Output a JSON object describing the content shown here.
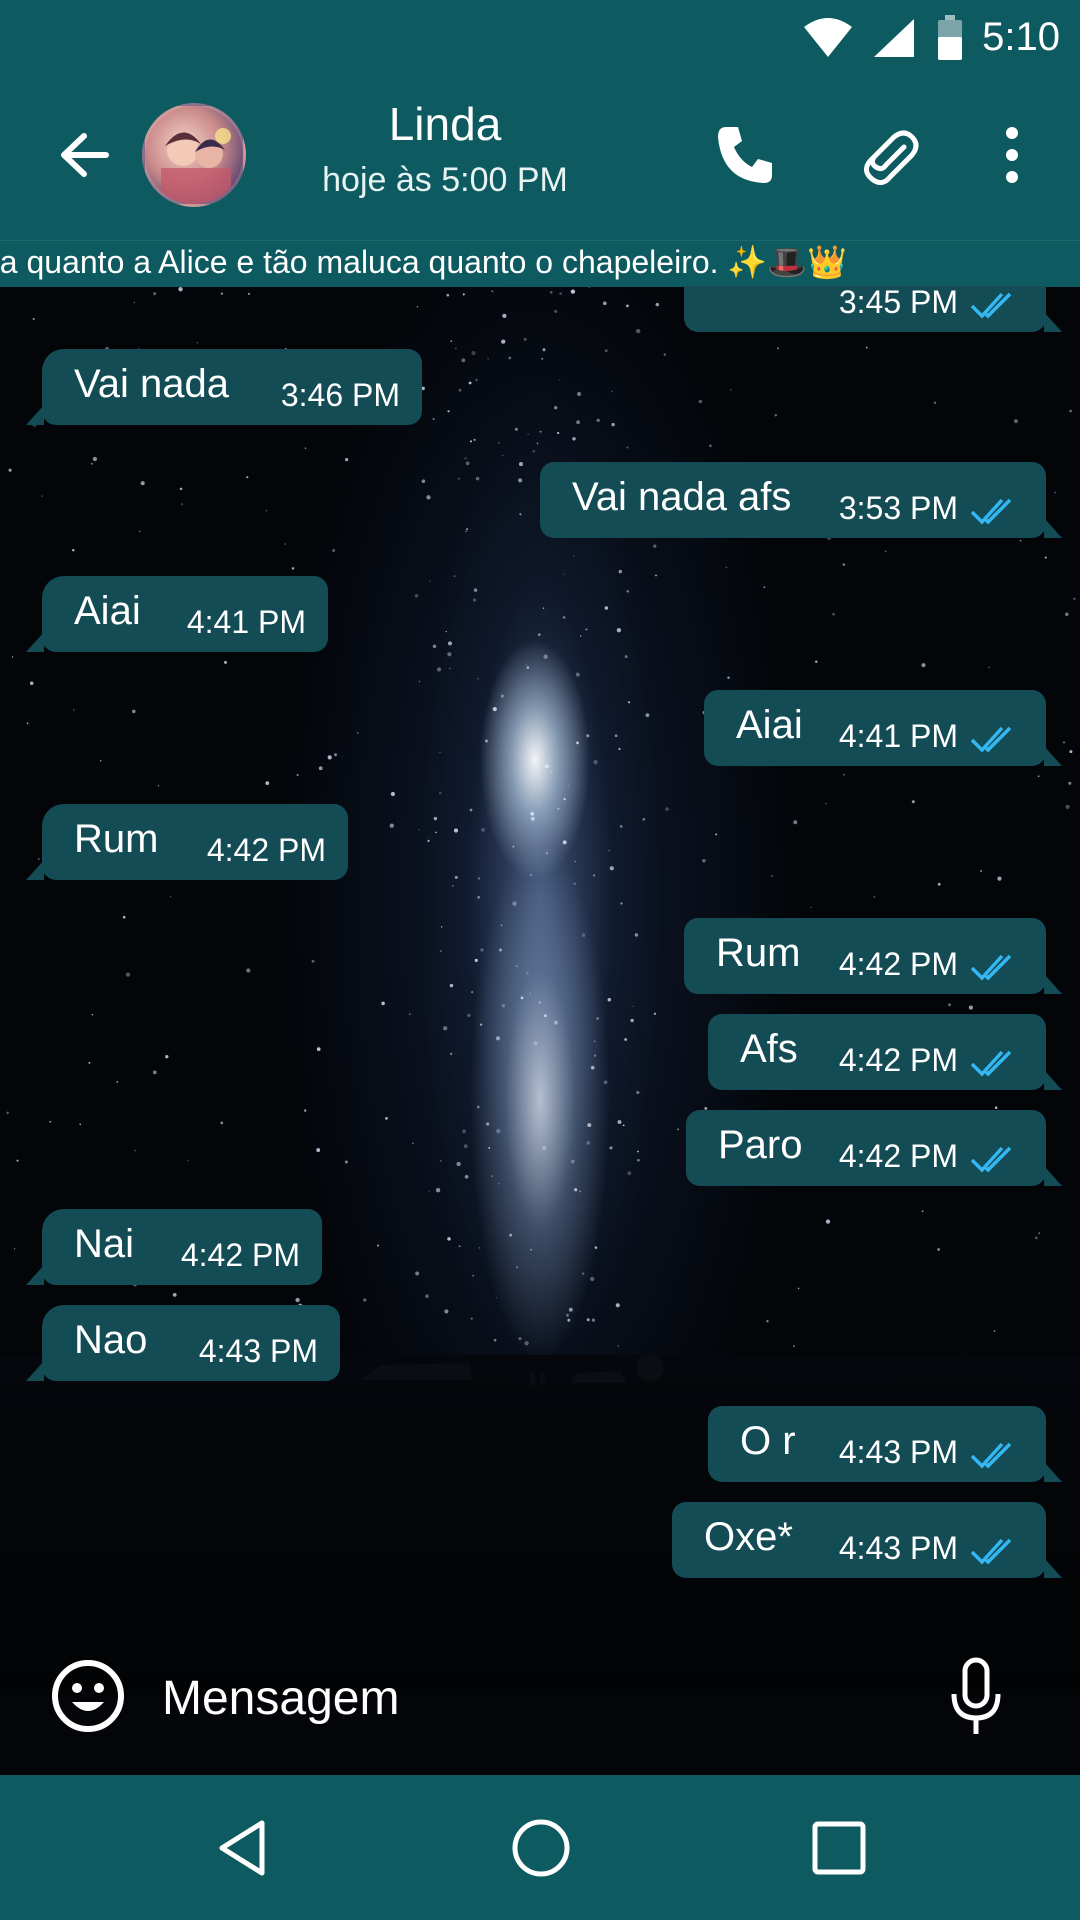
{
  "status_bar": {
    "time": "5:10",
    "icons": [
      "wifi-icon",
      "signal-icon",
      "battery-icon"
    ]
  },
  "header": {
    "contact_name": "Linda",
    "last_seen": "hoje às 5:00 PM",
    "actions": [
      "call-icon",
      "attach-icon",
      "more-vert-icon"
    ]
  },
  "marquee": {
    "text": "da quanto a Alice e tão maluca quanto o chapeleiro. ✨🎩👑"
  },
  "messages": [
    {
      "dir": "out",
      "text": "",
      "time": "3:45 PM",
      "partial": true
    },
    {
      "dir": "in",
      "text": "Vai nada",
      "time": "3:46 PM"
    },
    {
      "dir": "out",
      "text": "Vai nada afs",
      "time": "3:53 PM"
    },
    {
      "dir": "in",
      "text": "Aiai",
      "time": "4:41 PM"
    },
    {
      "dir": "out",
      "text": "Aiai",
      "time": "4:41 PM"
    },
    {
      "dir": "in",
      "text": "Rum",
      "time": "4:42 PM"
    },
    {
      "dir": "out",
      "text": "Rum",
      "time": "4:42 PM"
    },
    {
      "dir": "out",
      "text": "Afs",
      "time": "4:42 PM"
    },
    {
      "dir": "out",
      "text": "Paro",
      "time": "4:42 PM"
    },
    {
      "dir": "in",
      "text": "Nai",
      "time": "4:42 PM"
    },
    {
      "dir": "in",
      "text": "Nao",
      "time": "4:43 PM"
    },
    {
      "dir": "out",
      "text": "O r",
      "time": "4:43 PM"
    },
    {
      "dir": "out",
      "text": "Oxe*",
      "time": "4:43 PM"
    }
  ],
  "compose": {
    "placeholder": "Mensagem",
    "left_icon": "emoji-icon",
    "right_icon": "mic-icon"
  },
  "nav": {
    "icons": [
      "nav-back-icon",
      "nav-home-icon",
      "nav-recents-icon"
    ]
  },
  "colors": {
    "bar": "#0d5a61",
    "bubble": "#134c54",
    "read_ticks": "#34b7f1"
  }
}
